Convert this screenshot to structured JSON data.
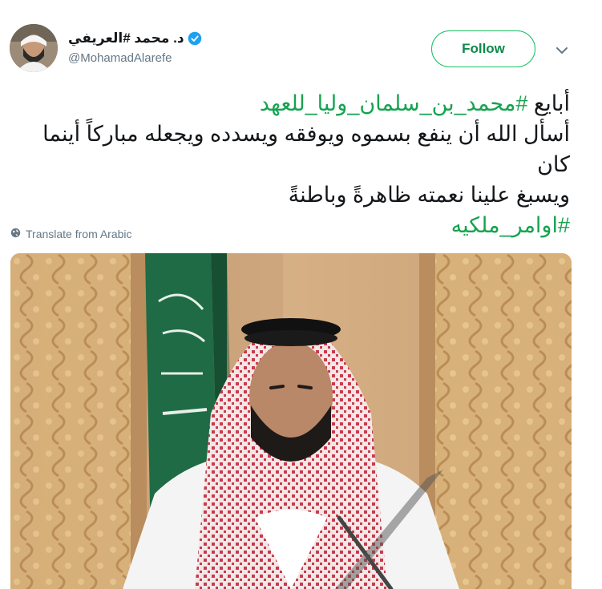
{
  "author": {
    "display_name": "د. محمد #العريفي",
    "handle": "@MohamadAlarefe",
    "verified_icon": "verified-badge-icon",
    "avatar_icon": "avatar"
  },
  "actions": {
    "follow_label": "Follow",
    "more_icon": "chevron-down-icon"
  },
  "tweet": {
    "line1_prefix": "أبايع ",
    "line1_hashtag": "#محمد_بن_سلمان_وليا_للعهد",
    "line2": "أسأل الله أن ينفع بسموه ويوفقه ويسدده ويجعله مباركاً أينما كان",
    "line3": "ويسبغ علينا نعمته ظاهرةً وباطنةً",
    "line4_hashtag": "#اوامر_ملكيه",
    "translate_label": "Translate from Arabic",
    "translate_icon": "globe-icon"
  },
  "colors": {
    "hashtag": "#17a350",
    "follow_border": "#17bf63",
    "secondary_text": "#657786"
  }
}
